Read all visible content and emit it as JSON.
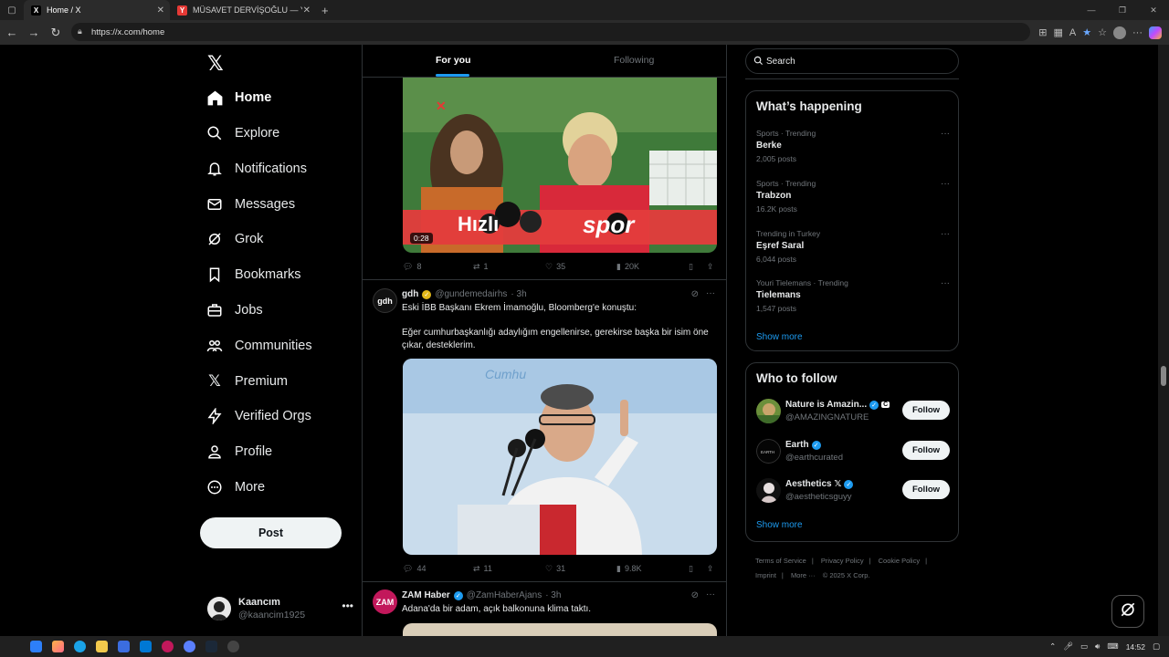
{
  "browser": {
    "tabs": [
      {
        "title": "Home / X",
        "favicon": "X",
        "active": true
      },
      {
        "title": "MÜSAVET DERVİŞOĞLU — Yande",
        "favicon": "Y",
        "active": false
      }
    ],
    "url": "https://x.com/home"
  },
  "sidebar": {
    "items": [
      {
        "label": "Home",
        "icon": "home-icon"
      },
      {
        "label": "Explore",
        "icon": "search-icon"
      },
      {
        "label": "Notifications",
        "icon": "bell-icon"
      },
      {
        "label": "Messages",
        "icon": "mail-icon"
      },
      {
        "label": "Grok",
        "icon": "grok-icon"
      },
      {
        "label": "Bookmarks",
        "icon": "bookmark-icon"
      },
      {
        "label": "Jobs",
        "icon": "briefcase-icon"
      },
      {
        "label": "Communities",
        "icon": "people-icon"
      },
      {
        "label": "Premium",
        "icon": "x-icon"
      },
      {
        "label": "Verified Orgs",
        "icon": "lightning-icon"
      },
      {
        "label": "Profile",
        "icon": "person-icon"
      },
      {
        "label": "More",
        "icon": "more-circle-icon"
      }
    ],
    "post_label": "Post",
    "account": {
      "name": "Kaancım",
      "handle": "@kaancim1925"
    }
  },
  "feed": {
    "tabs": [
      "For you",
      "Following"
    ],
    "post1": {
      "video_duration": "0:28",
      "banner_left": "Hızlı",
      "banner_right": "spor",
      "stats": {
        "replies": "8",
        "reposts": "1",
        "likes": "35",
        "views": "20K"
      }
    },
    "post2": {
      "name": "gdh",
      "avatar_text": "gdh",
      "handle": "@gundemedairhs",
      "time": "· 3h",
      "text1": "Eski İBB Başkanı Ekrem İmamoğlu, Bloomberg'e konuştu:",
      "text2": "Eğer cumhurbaşkanlığı adaylığım engellenirse, gerekirse başka bir isim öne çıkar, desteklerim.",
      "stats": {
        "replies": "44",
        "reposts": "11",
        "likes": "31",
        "views": "9.8K"
      }
    },
    "post3": {
      "name": "ZAM Haber",
      "avatar_text": "ZAM",
      "handle": "@ZamHaberAjans",
      "time": "· 3h",
      "text": "Adana'da bir adam, açık balkonuna klima taktı."
    }
  },
  "right": {
    "search_placeholder": "Search",
    "happening_title": "What’s happening",
    "trends": [
      {
        "category": "Sports · Trending",
        "title": "Berke",
        "count": "2,005 posts"
      },
      {
        "category": "Sports · Trending",
        "title": "Trabzon",
        "count": "16.2K posts"
      },
      {
        "category": "Trending in Turkey",
        "title": "Eşref Saral",
        "count": "6,044 posts"
      },
      {
        "category": "Youri Tielemans · Trending",
        "title": "Tielemans",
        "count": "1,547 posts"
      }
    ],
    "show_more": "Show more",
    "wtf_title": "Who to follow",
    "follow_label": "Follow",
    "who_to_follow": [
      {
        "name": "Nature is Amazin...",
        "handle": "@AMAZINGNATURE"
      },
      {
        "name": "Earth",
        "handle": "@earthcurated"
      },
      {
        "name": "Aesthetics 𝕏",
        "handle": "@aestheticsguyy"
      }
    ],
    "footer": {
      "links": [
        "Terms of Service",
        "Privacy Policy",
        "Cookie Policy",
        "Imprint",
        "More ···"
      ],
      "copyright": "© 2025 X Corp."
    }
  },
  "taskbar": {
    "time": "14:52"
  },
  "colors": {
    "accent": "#1d9bf0",
    "background": "#000000",
    "border": "#2f3336",
    "muted": "#71767b"
  }
}
